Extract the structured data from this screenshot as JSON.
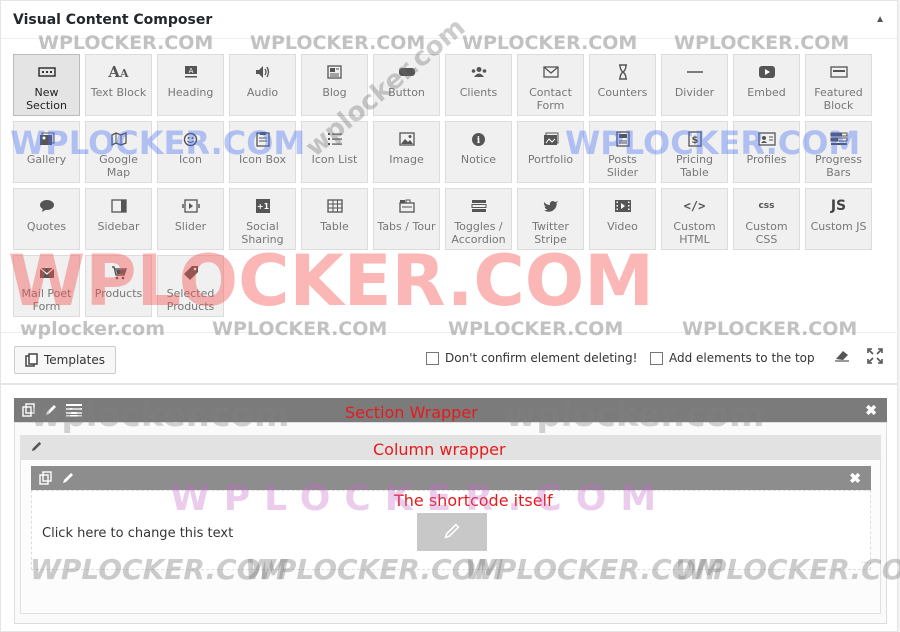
{
  "panel": {
    "title": "Visual Content Composer",
    "collapse_icon": "triangle-up-icon"
  },
  "elements": [
    [
      {
        "label": "New\nSection",
        "icon": "section-icon",
        "active": true
      },
      {
        "label": "Text Block",
        "icon": "text-icon"
      },
      {
        "label": "Heading",
        "icon": "heading-icon"
      },
      {
        "label": "Audio",
        "icon": "audio-icon"
      },
      {
        "label": "Blog",
        "icon": "blog-icon"
      },
      {
        "label": "Button",
        "icon": "button-icon"
      },
      {
        "label": "Clients",
        "icon": "clients-icon"
      },
      {
        "label": "Contact\nForm",
        "icon": "mail-icon"
      },
      {
        "label": "Counters",
        "icon": "hourglass-icon"
      },
      {
        "label": "Divider",
        "icon": "divider-icon"
      },
      {
        "label": "Embed",
        "icon": "play-icon"
      },
      {
        "label": "Featured\nBlock",
        "icon": "featured-icon"
      }
    ],
    [
      {
        "label": "Gallery",
        "icon": "gallery-icon"
      },
      {
        "label": "Google\nMap",
        "icon": "map-icon"
      },
      {
        "label": "Icon",
        "icon": "smiley-icon"
      },
      {
        "label": "Icon Box",
        "icon": "clipboard-icon"
      },
      {
        "label": "Icon List",
        "icon": "list-icon"
      },
      {
        "label": "Image",
        "icon": "image-icon"
      },
      {
        "label": "Notice",
        "icon": "info-icon"
      },
      {
        "label": "Portfolio",
        "icon": "portfolio-icon"
      },
      {
        "label": "Posts\nSlider",
        "icon": "posts-icon"
      },
      {
        "label": "Pricing\nTable",
        "icon": "dollar-icon"
      },
      {
        "label": "Profiles",
        "icon": "profile-card-icon"
      },
      {
        "label": "Progress\nBars",
        "icon": "bars-icon"
      }
    ],
    [
      {
        "label": "Quotes",
        "icon": "speech-bubble-icon"
      },
      {
        "label": "Sidebar",
        "icon": "sidebar-icon"
      },
      {
        "label": "Slider",
        "icon": "slider-icon"
      },
      {
        "label": "Social\nSharing",
        "icon": "share-icon"
      },
      {
        "label": "Table",
        "icon": "table-icon"
      },
      {
        "label": "Tabs / Tour",
        "icon": "tabs-icon"
      },
      {
        "label": "Toggles /\nAccordion",
        "icon": "toggle-icon"
      },
      {
        "label": "Twitter\nStripe",
        "icon": "twitter-icon"
      },
      {
        "label": "Video",
        "icon": "film-icon"
      },
      {
        "label": "Custom\nHTML",
        "icon": "code-icon"
      },
      {
        "label": "Custom\nCSS",
        "icon": "css-icon"
      },
      {
        "label": "Custom JS",
        "icon": "js-icon"
      }
    ],
    [
      {
        "label": "Mail Poet\nForm",
        "icon": "envelope-icon"
      },
      {
        "label": "Products",
        "icon": "cart-icon"
      },
      {
        "label": "Selected\nProducts",
        "icon": "tag-icon"
      }
    ]
  ],
  "toolbar": {
    "templates_label": "Templates",
    "confirm_delete_label": "Don't confirm element deleting!",
    "add_top_label": "Add elements to the top"
  },
  "builder": {
    "shortcode_text": "Click here to change this text"
  },
  "annotations": {
    "section": "Section Wrapper",
    "column": "Column wrapper",
    "shortcode": "The shortcode itself"
  },
  "watermarks": {
    "top_row": [
      "WPLOCKER.COM",
      "WPLOCKER.COM",
      "WPLOCKER.COM",
      "WPLOCKER.COM"
    ],
    "blue_left": "WPLOCKER.COM",
    "blue_right": "WPLOCKER.COM",
    "diagonal": "wplocker.com",
    "big_red": "WPLOCKER.COM",
    "mid_row": [
      "wplocker.com",
      "WPLOCKER.COM",
      "WPLOCKER.COM",
      "WPLOCKER.COM"
    ],
    "builder_gray_left": "wplocker.com",
    "builder_gray_right": "wplocker.com",
    "purple": "WPLOCKER.COM",
    "bottom_row": [
      "WPLOCKER.COM",
      "WPLOCKER.COM",
      "WPLOCKER.COM",
      "WPLOCKER.COM"
    ]
  },
  "colors": {
    "annotation": "#e8191b",
    "section_bar": "#7b7b7b",
    "shortcode_bar": "#8d8d8d"
  }
}
